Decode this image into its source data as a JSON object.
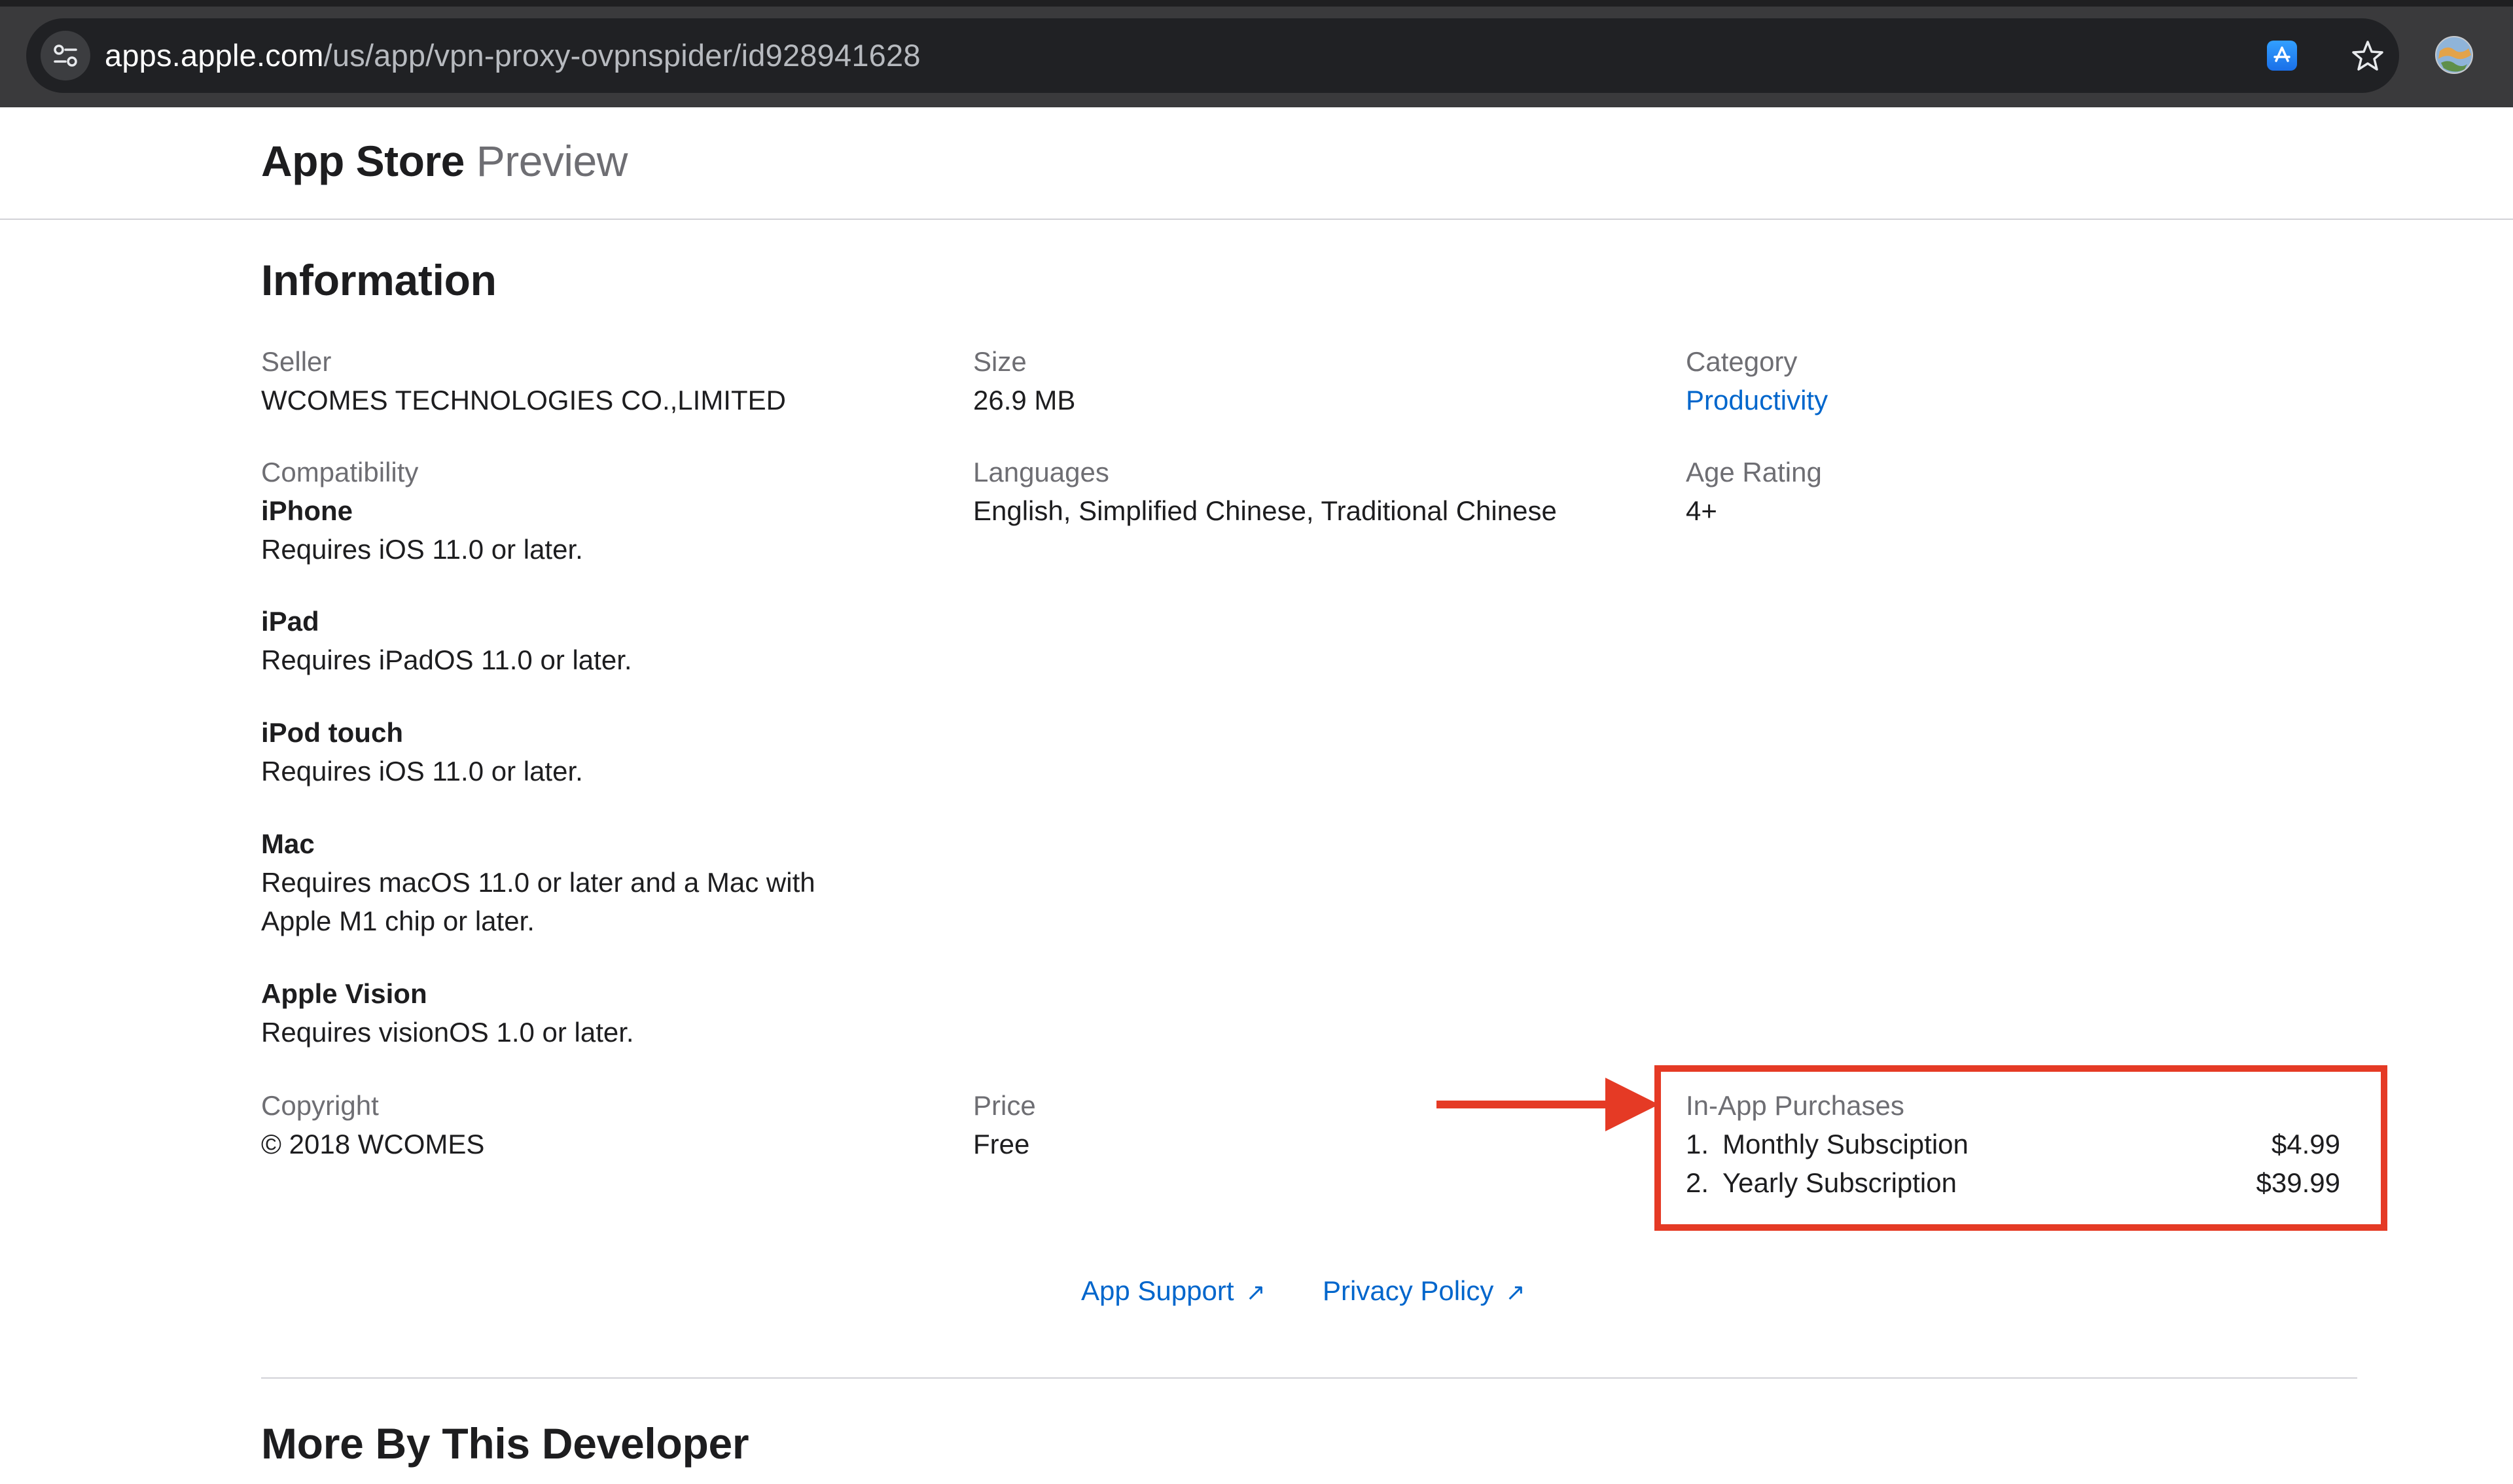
{
  "browser": {
    "url_host": "apps.apple.com",
    "url_path": "/us/app/vpn-proxy-ovpnspider/id928941628"
  },
  "header": {
    "logo_bold": "App Store",
    "logo_light": "Preview"
  },
  "information": {
    "title": "Information",
    "seller": {
      "label": "Seller",
      "value": "WCOMES TECHNOLOGIES CO.,LIMITED"
    },
    "size": {
      "label": "Size",
      "value": "26.9 MB"
    },
    "category": {
      "label": "Category",
      "value": "Productivity"
    },
    "compatibility": {
      "label": "Compatibility",
      "devices": [
        {
          "name": "iPhone",
          "requirement": "Requires iOS 11.0 or later."
        },
        {
          "name": "iPad",
          "requirement": "Requires iPadOS 11.0 or later."
        },
        {
          "name": "iPod touch",
          "requirement": "Requires iOS 11.0 or later."
        },
        {
          "name": "Mac",
          "requirement": "Requires macOS 11.0 or later and a Mac with",
          "requirement_line2": "Apple M1 chip or later."
        },
        {
          "name": "Apple Vision",
          "requirement": "Requires visionOS 1.0 or later."
        }
      ]
    },
    "languages": {
      "label": "Languages",
      "value": "English, Simplified Chinese, Traditional Chinese"
    },
    "age_rating": {
      "label": "Age Rating",
      "value": "4+"
    },
    "copyright": {
      "label": "Copyright",
      "value": "© 2018 WCOMES"
    },
    "price": {
      "label": "Price",
      "value": "Free"
    },
    "in_app_purchases": {
      "label": "In-App Purchases",
      "items": [
        {
          "num": "1.",
          "name": "Monthly Subsciption",
          "price": "$4.99"
        },
        {
          "num": "2.",
          "name": "Yearly Subscription",
          "price": "$39.99"
        }
      ]
    }
  },
  "links": {
    "app_support": "App Support",
    "privacy_policy": "Privacy Policy"
  },
  "more_by_developer": {
    "title": "More By This Developer"
  },
  "colors": {
    "link": "#0066cc",
    "annotation": "#e53a25",
    "text_primary": "#1d1d1f",
    "text_secondary": "#6e6e73"
  }
}
